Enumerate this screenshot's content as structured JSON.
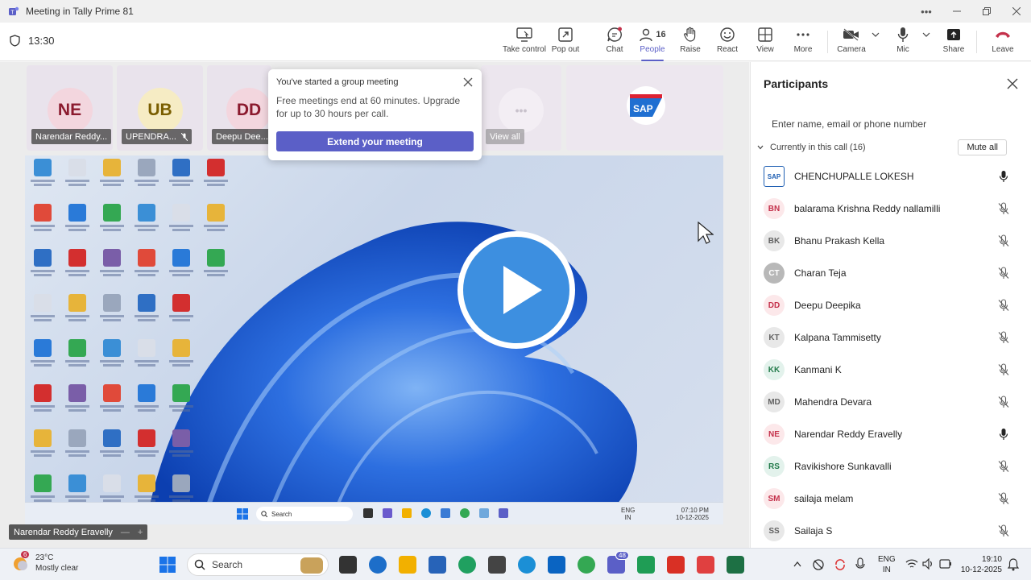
{
  "window": {
    "title": "Meeting in Tally Prime 81",
    "controls": [
      "more-icon",
      "minimize-icon",
      "restore-icon",
      "close-icon"
    ]
  },
  "toolbar": {
    "timer": "13:30",
    "buttons": [
      {
        "label": "Take control",
        "icon": "take-control-icon"
      },
      {
        "label": "Pop out",
        "icon": "pop-out-icon"
      },
      {
        "label": "Chat",
        "icon": "chat-icon"
      },
      {
        "label": "People",
        "icon": "people-icon",
        "count": "16",
        "active": true
      },
      {
        "label": "Raise",
        "icon": "raise-hand-icon"
      },
      {
        "label": "React",
        "icon": "react-icon"
      },
      {
        "label": "View",
        "icon": "view-icon"
      },
      {
        "label": "More",
        "icon": "more-icon"
      },
      {
        "label": "Camera",
        "icon": "camera-off-icon"
      },
      {
        "label": "Mic",
        "icon": "mic-icon"
      },
      {
        "label": "Share",
        "icon": "share-icon"
      },
      {
        "label": "Leave",
        "icon": "leave-icon"
      }
    ]
  },
  "tiles": [
    {
      "initials": "NE",
      "name": "Narendar Reddy...",
      "color": "#c4314b"
    },
    {
      "initials": "UB",
      "name": "UPENDRA...",
      "color": "#8a6d00"
    },
    {
      "initials": "DD",
      "name": "Deepu Dee...",
      "color": "#c4314b"
    },
    {
      "view_all": "View all"
    }
  ],
  "popup": {
    "title": "You've started a group meeting",
    "body": "Free meetings end at 60 minutes. Upgrade for up to 30 hours per call.",
    "button": "Extend your meeting"
  },
  "shared_screen": {
    "taskbar_search": "Search",
    "lang": "ENG",
    "region": "IN",
    "time": "07:10 PM",
    "date": "10-12-2025"
  },
  "speaker_tag": "Narendar Reddy Eravelly",
  "participants_panel": {
    "title": "Participants",
    "search_placeholder": "Enter name, email or phone number",
    "section": "Currently in this call (16)",
    "mute_all": "Mute all",
    "people": [
      {
        "initials": "SAP",
        "name": "CHENCHUPALLE LOKESH",
        "mic": "on",
        "bg": "#ffffff",
        "fg": "#1f5fb3"
      },
      {
        "initials": "BN",
        "name": "balarama Krishna Reddy nallamilli",
        "mic": "off",
        "bg": "#fce8ea",
        "fg": "#c4314b"
      },
      {
        "initials": "BK",
        "name": "Bhanu Prakash Kella",
        "mic": "off",
        "bg": "#e8e8e8",
        "fg": "#616161"
      },
      {
        "initials": "CT",
        "name": "Charan Teja",
        "mic": "off",
        "bg": "#b8b8b8",
        "fg": "#ffffff"
      },
      {
        "initials": "DD",
        "name": "Deepu Deepika",
        "mic": "off",
        "bg": "#fce8ea",
        "fg": "#c4314b"
      },
      {
        "initials": "KT",
        "name": "Kalpana Tammisetty",
        "mic": "off",
        "bg": "#e8e8e8",
        "fg": "#616161"
      },
      {
        "initials": "KK",
        "name": "Kanmani K",
        "mic": "off",
        "bg": "#e3f2ec",
        "fg": "#237b4b"
      },
      {
        "initials": "MD",
        "name": "Mahendra Devara",
        "mic": "off",
        "bg": "#e8e8e8",
        "fg": "#616161"
      },
      {
        "initials": "NE",
        "name": "Narendar Reddy Eravelly",
        "mic": "on",
        "bg": "#fce8ea",
        "fg": "#c4314b"
      },
      {
        "initials": "RS",
        "name": "Ravikishore Sunkavalli",
        "mic": "off",
        "bg": "#e3f2ec",
        "fg": "#237b4b"
      },
      {
        "initials": "SM",
        "name": "sailaja melam",
        "mic": "off",
        "bg": "#fce8ea",
        "fg": "#c4314b"
      },
      {
        "initials": "SS",
        "name": "Sailaja S",
        "mic": "off",
        "bg": "#e8e8e8",
        "fg": "#616161"
      }
    ]
  },
  "taskbar": {
    "weather_temp": "23°C",
    "weather_desc": "Mostly clear",
    "weather_badge": "6",
    "search": "Search",
    "lang": "ENG",
    "region": "IN",
    "time": "19:10",
    "date": "10-12-2025",
    "teams_badge": "48"
  },
  "colors": {
    "accent": "#5b5fc7",
    "leave": "#c4314b"
  }
}
